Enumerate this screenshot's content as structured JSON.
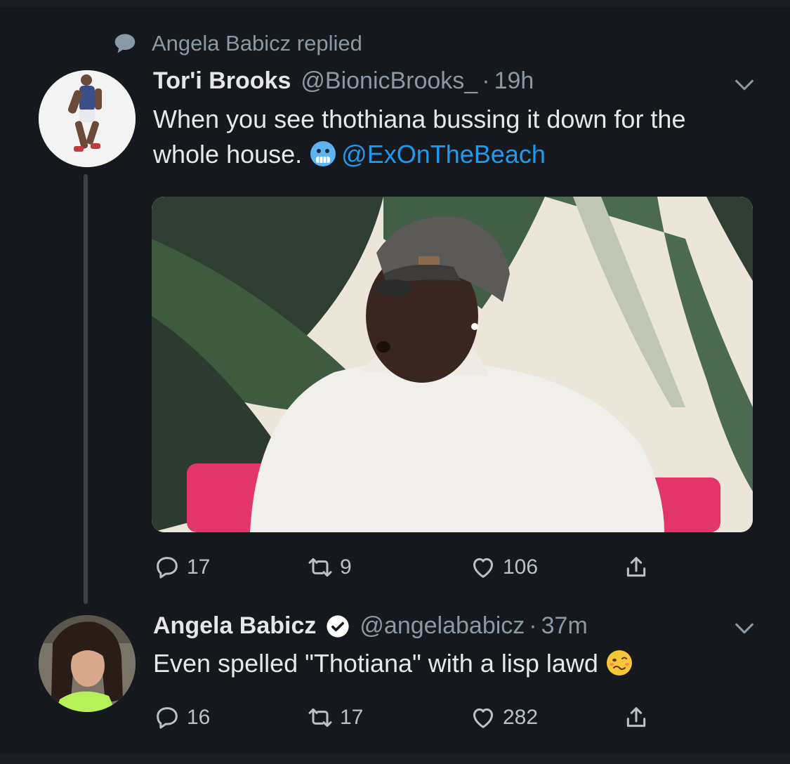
{
  "context": {
    "label": "Angela Babicz replied",
    "icon": "speech-bubble-icon"
  },
  "original_tweet": {
    "name": "Tor'i Brooks",
    "handle": "@BionicBrooks_",
    "separator": "·",
    "time": "19h",
    "text": "When you see thothiana bussing it down for the whole house.",
    "emoji": "cold-face-emoji",
    "mention": "@ExOnTheBeach",
    "actions": {
      "replies": "17",
      "retweets": "9",
      "likes": "106"
    }
  },
  "reply_tweet": {
    "name": "Angela Babicz",
    "verified": true,
    "handle": "@angelababicz",
    "separator": "·",
    "time": "37m",
    "text": "Even spelled \"Thotiana\" with a lisp lawd",
    "emoji": "woozy-face-emoji",
    "actions": {
      "replies": "16",
      "retweets": "17",
      "likes": "282"
    }
  },
  "colors": {
    "background": "#15181c",
    "link": "#1d9bf0",
    "muted": "#8b98a5",
    "text": "#e8e8e8"
  }
}
